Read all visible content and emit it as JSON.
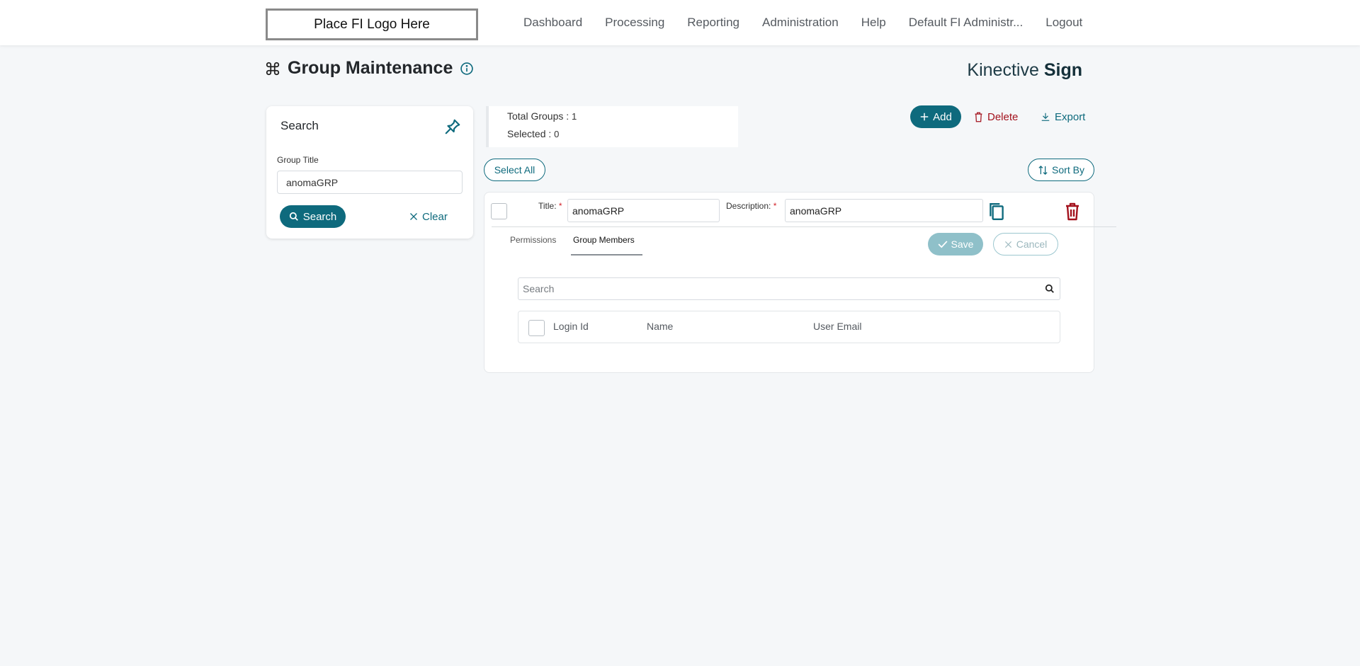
{
  "header": {
    "logo_text": "Place FI Logo Here",
    "nav": [
      "Dashboard",
      "Processing",
      "Reporting",
      "Administration",
      "Help",
      "Default FI Administr...",
      "Logout"
    ]
  },
  "page": {
    "title": "Group Maintenance",
    "brand_light": "Kinective",
    "brand_bold": "Sign"
  },
  "search_panel": {
    "title": "Search",
    "field_label": "Group Title",
    "field_value": "anomaGRP",
    "search_label": "Search",
    "clear_label": "Clear"
  },
  "totals": {
    "total_label": "Total Groups :",
    "total_value": "1",
    "selected_label": "Selected :",
    "selected_value": "0"
  },
  "actions": {
    "add_label": "Add",
    "delete_label": "Delete",
    "export_label": "Export",
    "select_all_label": "Select All",
    "sort_by_label": "Sort By"
  },
  "group": {
    "title_label": "Title:",
    "title_value": "anomaGRP",
    "description_label": "Description:",
    "description_value": "anomaGRP",
    "required_mark": "*",
    "tabs": [
      "Permissions",
      "Group Members"
    ],
    "active_tab": "Group Members",
    "save_label": "Save",
    "cancel_label": "Cancel",
    "member_search_placeholder": "Search",
    "columns": [
      "Login Id",
      "Name",
      "User Email"
    ]
  },
  "colors": {
    "accent": "#0e6a7d",
    "danger": "#a3121d",
    "background": "#f5f7f9"
  }
}
